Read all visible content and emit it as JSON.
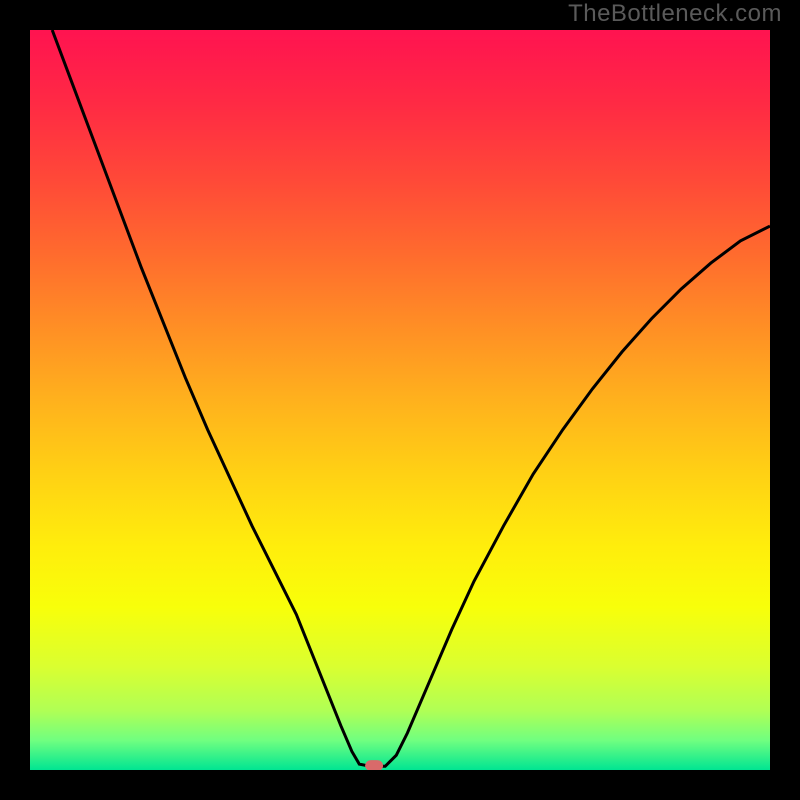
{
  "watermark": "TheBottleneck.com",
  "chart_data": {
    "type": "line",
    "title": "",
    "xlabel": "",
    "ylabel": "",
    "xlim": [
      0,
      100
    ],
    "ylim": [
      0,
      100
    ],
    "gradient_stops": [
      {
        "offset": 0.0,
        "color": "#ff1350"
      },
      {
        "offset": 0.1,
        "color": "#ff2a44"
      },
      {
        "offset": 0.2,
        "color": "#ff4838"
      },
      {
        "offset": 0.3,
        "color": "#ff6a2e"
      },
      {
        "offset": 0.4,
        "color": "#ff8e25"
      },
      {
        "offset": 0.5,
        "color": "#ffb11d"
      },
      {
        "offset": 0.6,
        "color": "#ffd114"
      },
      {
        "offset": 0.7,
        "color": "#ffee0c"
      },
      {
        "offset": 0.78,
        "color": "#f8ff0a"
      },
      {
        "offset": 0.86,
        "color": "#daff30"
      },
      {
        "offset": 0.92,
        "color": "#b0ff55"
      },
      {
        "offset": 0.96,
        "color": "#70ff80"
      },
      {
        "offset": 1.0,
        "color": "#00e592"
      }
    ],
    "marker": {
      "x": 46.5,
      "y": 0.6,
      "color": "#d96a6a"
    },
    "series": [
      {
        "name": "bottleneck-curve",
        "color": "#000000",
        "xy": [
          [
            3.0,
            100.0
          ],
          [
            6.0,
            92.0
          ],
          [
            9.0,
            84.0
          ],
          [
            12.0,
            76.0
          ],
          [
            15.0,
            68.0
          ],
          [
            18.0,
            60.5
          ],
          [
            21.0,
            53.0
          ],
          [
            24.0,
            46.0
          ],
          [
            27.0,
            39.5
          ],
          [
            30.0,
            33.0
          ],
          [
            33.0,
            27.0
          ],
          [
            36.0,
            21.0
          ],
          [
            38.0,
            16.0
          ],
          [
            40.0,
            11.0
          ],
          [
            42.0,
            6.0
          ],
          [
            43.5,
            2.5
          ],
          [
            44.5,
            0.8
          ],
          [
            46.0,
            0.5
          ],
          [
            48.0,
            0.5
          ],
          [
            49.5,
            2.0
          ],
          [
            51.0,
            5.0
          ],
          [
            54.0,
            12.0
          ],
          [
            57.0,
            19.0
          ],
          [
            60.0,
            25.5
          ],
          [
            64.0,
            33.0
          ],
          [
            68.0,
            40.0
          ],
          [
            72.0,
            46.0
          ],
          [
            76.0,
            51.5
          ],
          [
            80.0,
            56.5
          ],
          [
            84.0,
            61.0
          ],
          [
            88.0,
            65.0
          ],
          [
            92.0,
            68.5
          ],
          [
            96.0,
            71.5
          ],
          [
            100.0,
            73.5
          ]
        ]
      }
    ]
  }
}
